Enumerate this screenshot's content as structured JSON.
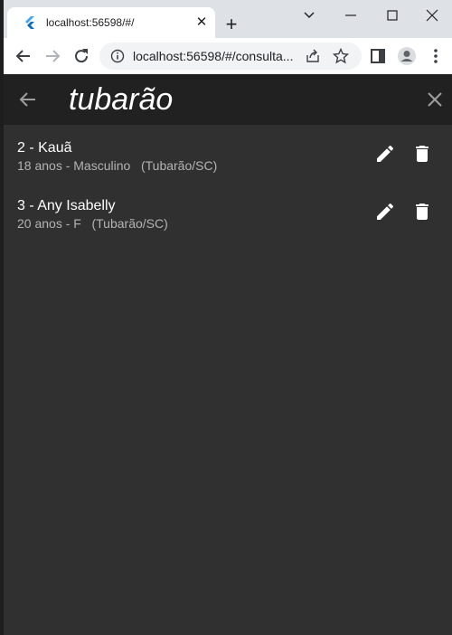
{
  "browser": {
    "tab_title": "localhost:56598/#/",
    "tab_close": "✕",
    "new_tab": "+",
    "url": "localhost:56598/#/consulta..."
  },
  "appbar": {
    "search_text": "tubarão"
  },
  "items": [
    {
      "title": "2 - Kauã",
      "subtitle": "18 anos - Masculino   (Tubarão/SC)"
    },
    {
      "title": "3 - Any Isabelly",
      "subtitle": "20 anos - F   (Tubarão/SC)"
    }
  ],
  "icons": {
    "back": "arrow-back-icon",
    "clear": "close-icon",
    "edit": "pencil-icon",
    "delete": "trash-icon"
  },
  "colors": {
    "background": "#303030",
    "appbar": "#212121",
    "text": "#ffffff",
    "subtitle": "#b3b3b3"
  }
}
